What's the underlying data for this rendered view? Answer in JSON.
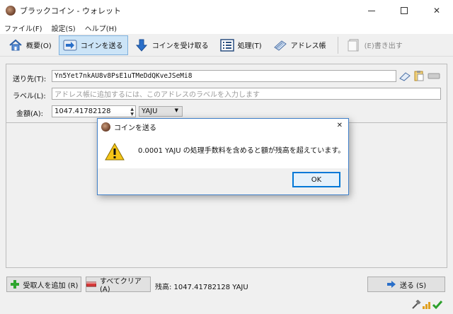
{
  "window": {
    "title": "ブラックコイン - ウォレット"
  },
  "menu": {
    "items": [
      "ファイル(F)",
      "設定(S)",
      "ヘルプ(H)"
    ]
  },
  "toolbar": {
    "overview": "概要(O)",
    "send": "コインを送る",
    "receive": "コインを受け取る",
    "transactions": "処理(T)",
    "addressbook": "アドレス帳",
    "export": "(E)書き出す"
  },
  "form": {
    "payto_label": "送り先(T):",
    "payto_value": "Yn5Yet7nkAU8v8PsE1uTMeDdQKveJSeMi8",
    "label_label": "ラベル(L):",
    "label_placeholder": "アドレス帳に追加するには、このアドレスのラベルを入力します",
    "amount_label": "金額(A):",
    "amount_value": "1047.41782128",
    "unit": "YAJU"
  },
  "bottom": {
    "add_recipient": "受取人を追加 (R)",
    "clear_all": "すべてクリア (A)",
    "balance": "残高: 1047.41782128 YAJU",
    "send": "送る (S)"
  },
  "dialog": {
    "title": "コインを送る",
    "message": "0.0001 YAJU の処理手数料を含めると額が残高を超えています。",
    "ok": "OK"
  }
}
